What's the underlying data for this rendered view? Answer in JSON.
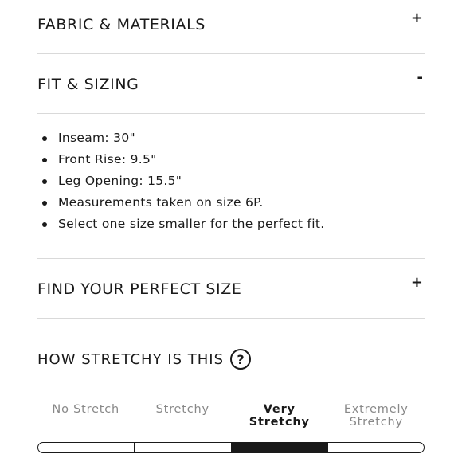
{
  "sections": {
    "fabric": {
      "title": "FABRIC & MATERIALS",
      "toggle": "+"
    },
    "fit": {
      "title": "FIT & SIZING",
      "toggle": "-",
      "items": [
        "Inseam: 30\"",
        "Front Rise: 9.5\"",
        "Leg Opening: 15.5\"",
        "Measurements taken on size 6P.",
        "Select one size smaller for the perfect fit."
      ]
    },
    "find_size": {
      "title": "FIND YOUR PERFECT SIZE",
      "toggle": "+"
    }
  },
  "stretch": {
    "title": "HOW STRETCHY IS THIS",
    "help_glyph": "?",
    "levels": [
      "No Stretch",
      "Stretchy",
      "Very Stretchy",
      "Extremely Stretchy"
    ],
    "selected_index": 2
  }
}
